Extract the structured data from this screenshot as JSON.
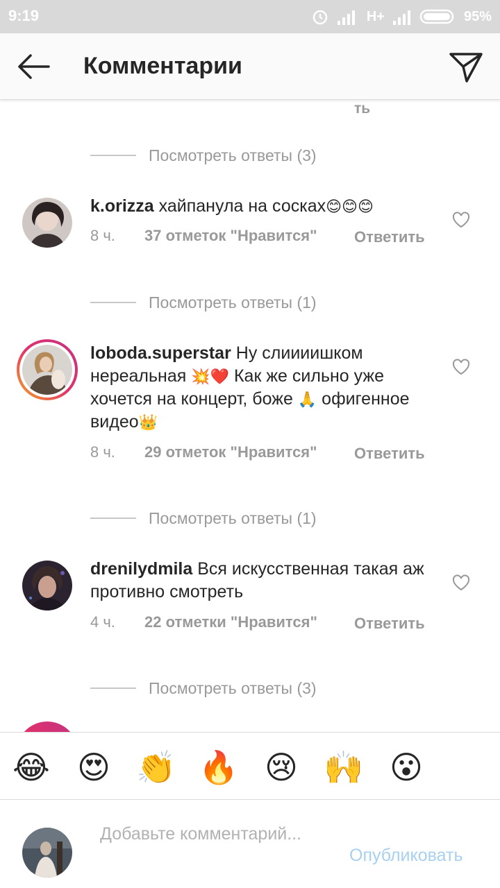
{
  "status_bar": {
    "time": "9:19",
    "network": "H+",
    "battery": "95%"
  },
  "header": {
    "title": "Комментарии"
  },
  "partial_top_reply": "ть",
  "comments": [
    {
      "username": "k.orizza",
      "text": "хайпанула на сосках",
      "text_emoji": "😊😊😊",
      "time": "8 ч.",
      "likes": "37 отметок \"Нравится\"",
      "reply": "Ответить",
      "has_story_ring": false,
      "view_replies_above": "Посмотреть ответы (3)"
    },
    {
      "username": "loboda.superstar",
      "text_part1": "Ну слиииишком нереальная",
      "emoji1": "💥❤️",
      "text_part2": "Как же сильно уже хочется на концерт, боже",
      "emoji2": "🙏",
      "text_part3": "офигенное видео",
      "emoji3": "👑",
      "time": "8 ч.",
      "likes": "29 отметок \"Нравится\"",
      "reply": "Ответить",
      "has_story_ring": true,
      "view_replies_above": "Посмотреть ответы (1)"
    },
    {
      "username": "drenilydmila",
      "text": "Вся искусственная такая аж противно смотреть",
      "time": "4 ч.",
      "likes": "22 отметки \"Нравится\"",
      "reply": "Ответить",
      "has_story_ring": false,
      "view_replies_above": "Посмотреть ответы (1)"
    }
  ],
  "view_replies_bottom": "Посмотреть ответы (3)",
  "emoji_bar": [
    "😂",
    "😍",
    "👏",
    "🔥",
    "😢",
    "🙌",
    "😮"
  ],
  "input": {
    "placeholder": "Добавьте комментарий...",
    "publish": "Опубликовать"
  },
  "colors": {
    "accent": "#3897f0",
    "publish_disabled": "#a8d0f0",
    "secondary_text": "#999999"
  }
}
